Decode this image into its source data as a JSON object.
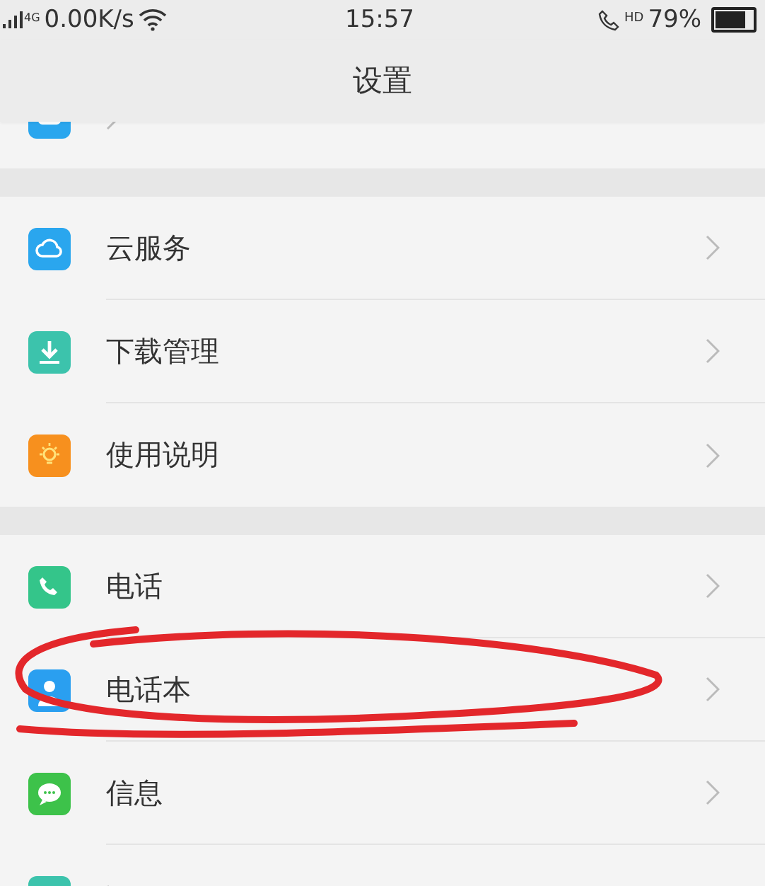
{
  "status_bar": {
    "network": "4G",
    "speed": "0.00K/s",
    "time": "15:57",
    "call_badge": "HD",
    "battery": "79%"
  },
  "header": {
    "title": "设置"
  },
  "sections": [
    {
      "items": [
        {
          "kind": "account"
        }
      ]
    },
    {
      "items": [
        {
          "kind": "cloud",
          "label": "云服务"
        },
        {
          "kind": "download",
          "label": "下载管理"
        },
        {
          "kind": "guide",
          "label": "使用说明"
        }
      ]
    },
    {
      "items": [
        {
          "kind": "phone",
          "label": "电话"
        },
        {
          "kind": "contacts",
          "label": "电话本",
          "annotated": true
        },
        {
          "kind": "message",
          "label": "信息"
        },
        {
          "kind": "app"
        }
      ]
    }
  ]
}
